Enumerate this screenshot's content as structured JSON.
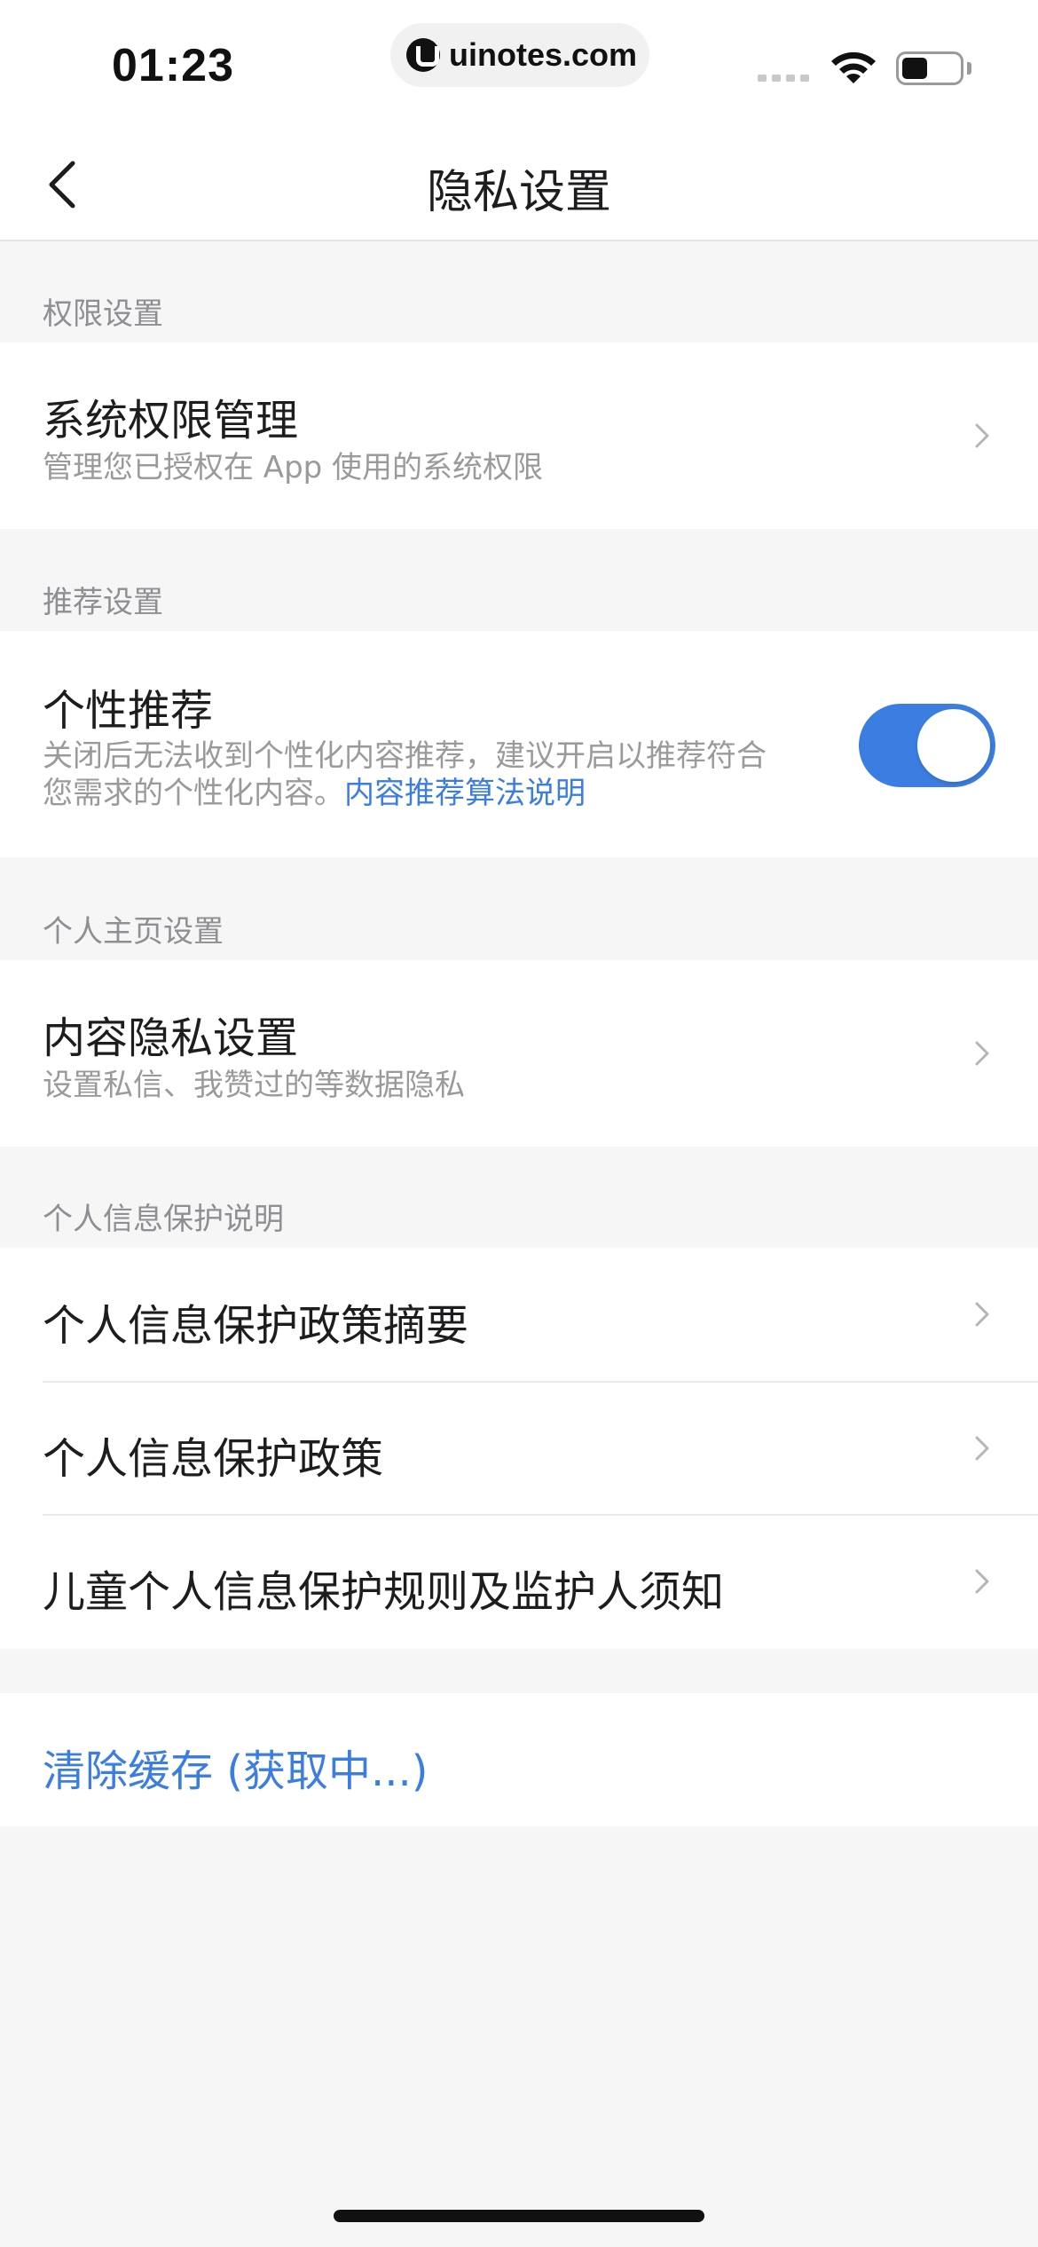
{
  "status_bar": {
    "time": "01:23",
    "url": "uinotes.com"
  },
  "nav": {
    "title": "隐私设置",
    "back_icon": "chevron-left-icon"
  },
  "sections": {
    "permission": {
      "label": "权限设置",
      "item_title": "系统权限管理",
      "item_sub": "管理您已授权在 App 使用的系统权限"
    },
    "recommend": {
      "label": "推荐设置",
      "item_title": "个性推荐",
      "item_sub_line1": "关闭后无法收到个性化内容推荐，建议开启以推荐符合",
      "item_sub_line2": "您需求的个性化内容。",
      "item_link": "内容推荐算法说明",
      "toggle_on": true
    },
    "profile": {
      "label": "个人主页设置",
      "item_title": "内容隐私设置",
      "item_sub": "设置私信、我赞过的等数据隐私"
    },
    "protection": {
      "label": "个人信息保护说明",
      "items": [
        "个人信息保护政策摘要",
        "个人信息保护政策",
        "儿童个人信息保护规则及监护人须知"
      ]
    },
    "cache": {
      "label": "清除缓存 (获取中...)"
    }
  },
  "colors": {
    "accent": "#3b7de0",
    "background": "#f6f6f6",
    "card": "#ffffff",
    "secondary_text": "#9a9a9a"
  }
}
